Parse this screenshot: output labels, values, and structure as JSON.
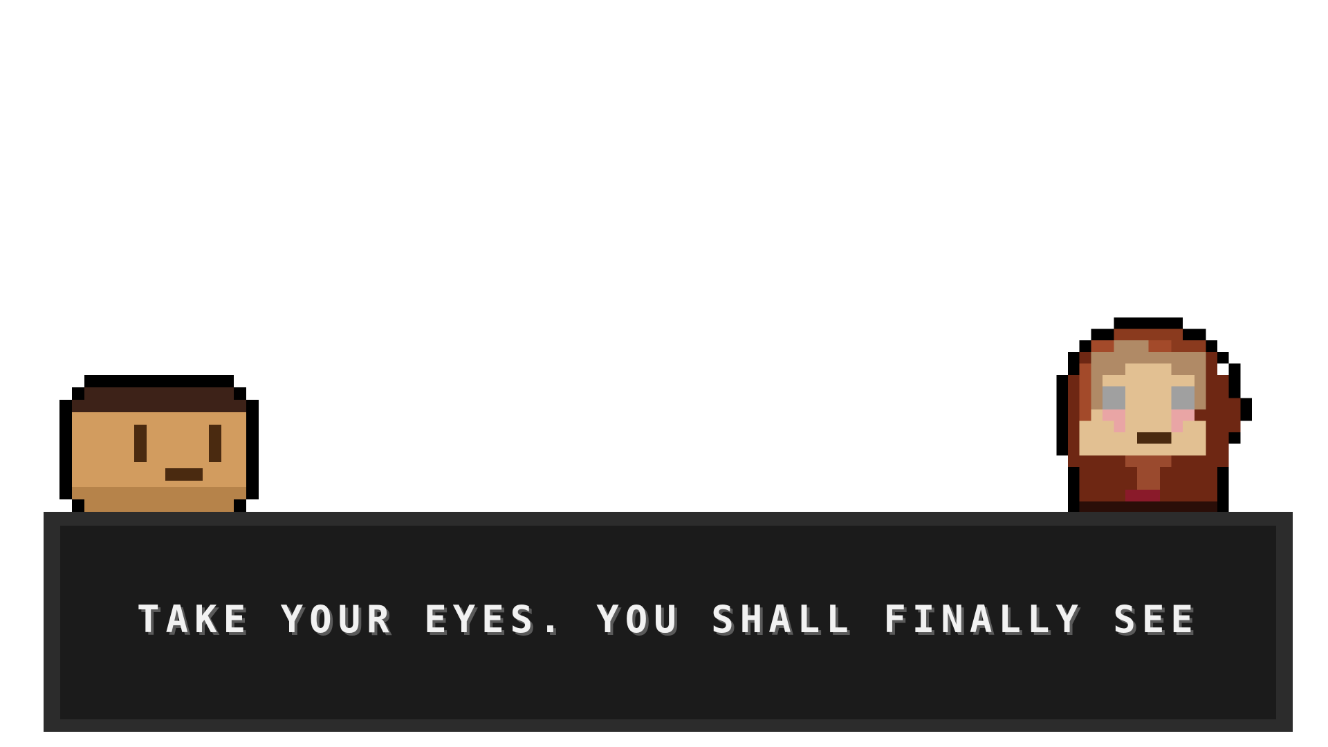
{
  "scene": {
    "background_color": "#ffffff"
  },
  "dialog": {
    "text": "TAKE YOUR EYES. YOU SHALL FINALLY SEE",
    "box_color": "#2c2c2c",
    "inner_color": "#1b1b1b",
    "text_color": "#f2f2f2"
  },
  "characters": {
    "left": {
      "portrait": "dark-haired-man-head-icon",
      "skin_color": "#d29c5f",
      "hair_color": "#3d2218"
    },
    "right": {
      "portrait": "red-haired-woman-head-icon",
      "skin_color": "#e2c092",
      "hair_color": "#6e2713",
      "eye_color": "#a0a0a0",
      "blush_color": "#e9a5a5"
    }
  }
}
